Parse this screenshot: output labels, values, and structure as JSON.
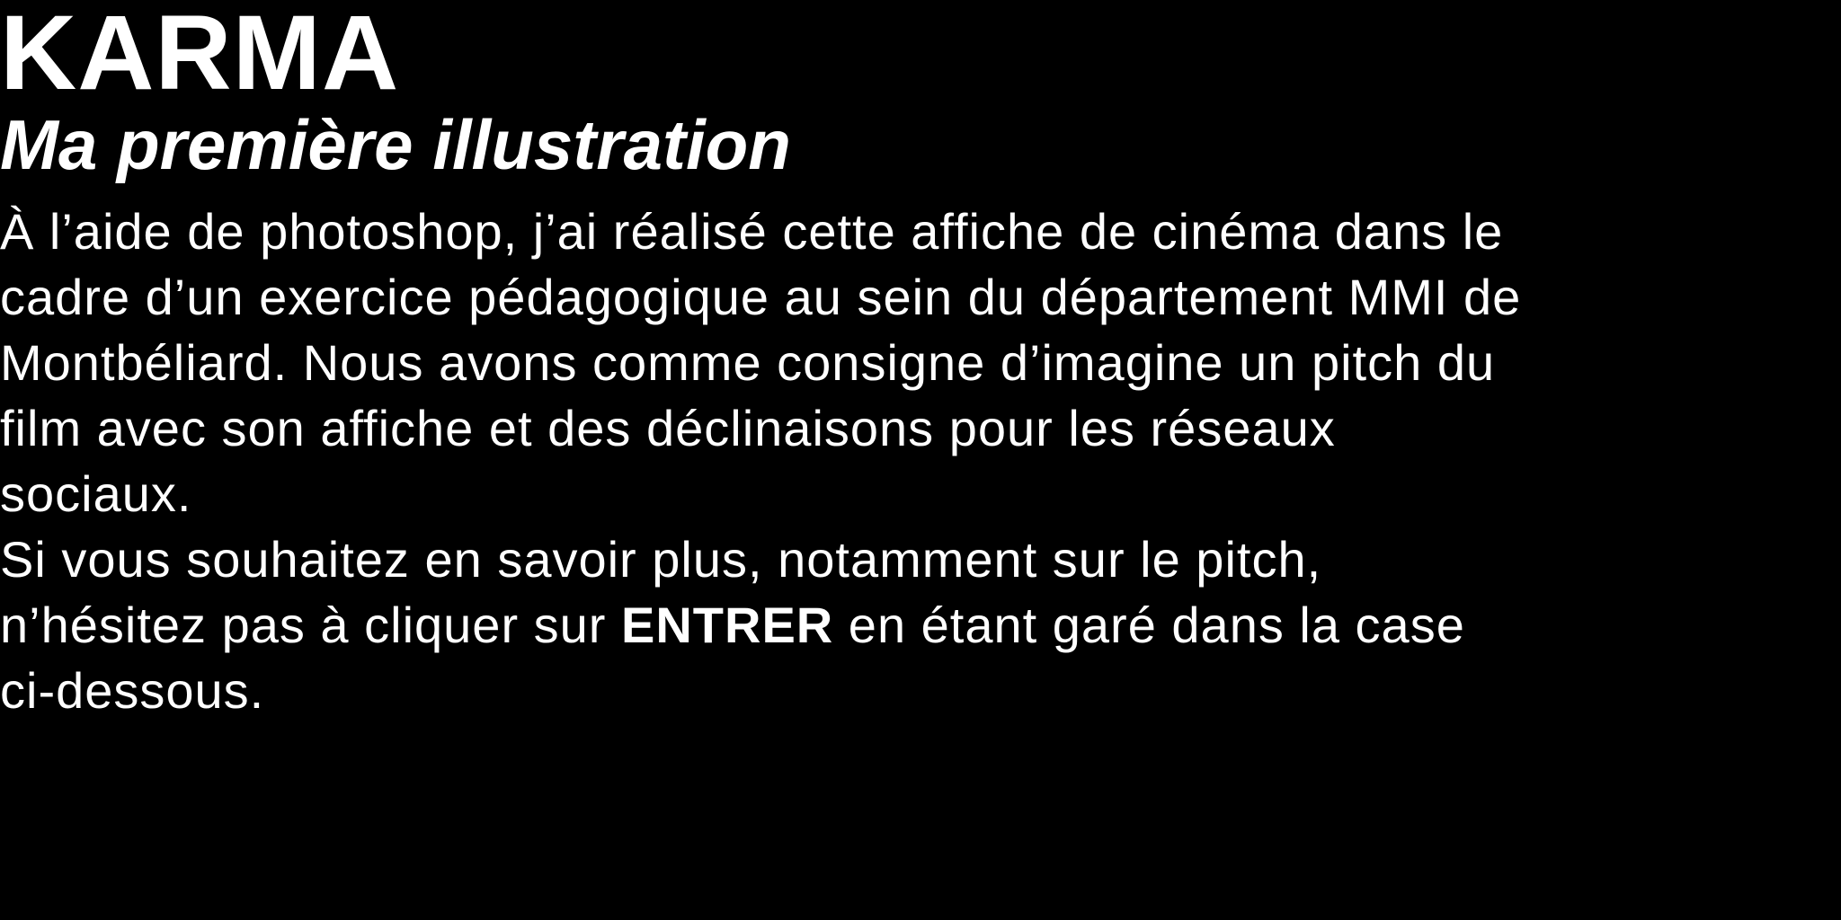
{
  "title": "KARMA",
  "subtitle": "Ma première illustration",
  "description": {
    "lines": [
      "À l’aide de photoshop, j’ai réalisé cette affiche de cinéma dans le",
      "cadre d’un exercice pédagogique au sein du département MMI de",
      "Montbéliard. Nous avons comme consigne d’imagine un pitch du",
      "film avec son affiche et des déclinaisons pour les réseaux",
      "sociaux."
    ]
  },
  "info": {
    "line1": "Si vous souhaitez en savoir plus, notamment sur le pitch,",
    "line2_before": "n’hésitez pas à cliquer sur ",
    "line2_bold": "ENTRER",
    "line2_after": " en étant garé  dans la case",
    "line3": "ci-dessous."
  },
  "colors": {
    "background": "#000000",
    "text": "#ffffff"
  }
}
